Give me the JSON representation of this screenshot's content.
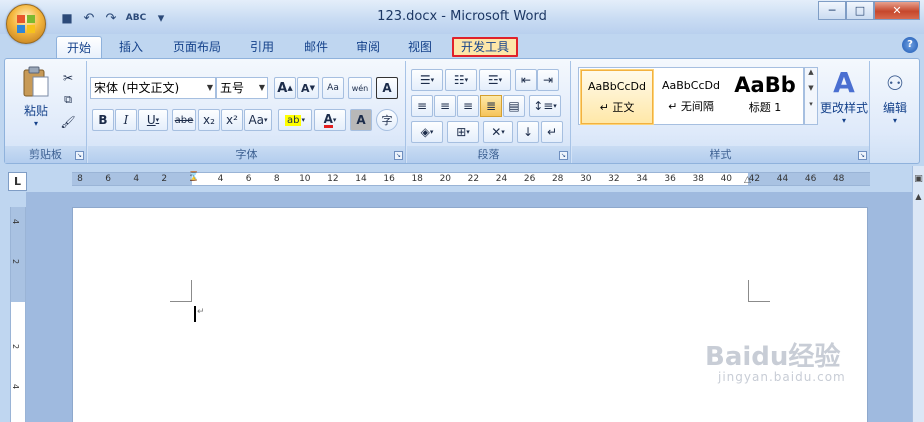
{
  "window": {
    "title": "123.docx - Microsoft Word",
    "minimize": "─",
    "maximize": "□",
    "close": "✕"
  },
  "qat": {
    "save": "💾",
    "undo": "↶",
    "redo": "↷",
    "spell": "ABC",
    "more": "▾"
  },
  "tabs": [
    {
      "label": "开始",
      "active": true
    },
    {
      "label": "插入"
    },
    {
      "label": "页面布局"
    },
    {
      "label": "引用"
    },
    {
      "label": "邮件"
    },
    {
      "label": "审阅"
    },
    {
      "label": "视图"
    },
    {
      "label": "开发工具",
      "highlighted": true
    }
  ],
  "help": "?",
  "groups": {
    "clipboard": {
      "label": "剪贴板",
      "paste": "粘贴"
    },
    "font": {
      "label": "字体",
      "font_name": "宋体 (中文正文)",
      "font_size": "五号",
      "bold": "B",
      "italic": "I",
      "underline": "U",
      "strike": "abe",
      "subscript": "x₂",
      "superscript": "x²",
      "case": "Aa",
      "grow": "A",
      "shrink": "A",
      "clear": "Aa",
      "phonetic": "wén",
      "border_char": "A",
      "font_color": "A",
      "shade_char": "A",
      "enclose": "字"
    },
    "paragraph": {
      "label": "段落"
    },
    "styles": {
      "label": "样式",
      "items": [
        {
          "sample": "AaBbCcDd",
          "name": "↵ 正文"
        },
        {
          "sample": "AaBbCcDd",
          "name": "↵ 无间隔"
        },
        {
          "sample": "AaBb",
          "name": "标题 1"
        }
      ],
      "change": "更改样式"
    },
    "editing": {
      "label": "编辑"
    }
  },
  "ruler": {
    "corner": "L",
    "ticks": [
      "8",
      "6",
      "4",
      "2",
      "2",
      "4",
      "6",
      "8",
      "10",
      "12",
      "14",
      "16",
      "18",
      "20",
      "22",
      "24",
      "26",
      "28",
      "30",
      "32",
      "34",
      "36",
      "38",
      "40",
      "42",
      "44",
      "46",
      "48"
    ],
    "vticks": [
      "4",
      "2",
      "2",
      "4"
    ]
  },
  "watermark": {
    "brand": "Baidu经验",
    "url": "jingyan.baidu.com"
  },
  "colors": {
    "accent": "#15428b",
    "highlight_box": "#e0222a",
    "font_color_bar": "#e21f1f",
    "highlighter": "#ffff00"
  }
}
